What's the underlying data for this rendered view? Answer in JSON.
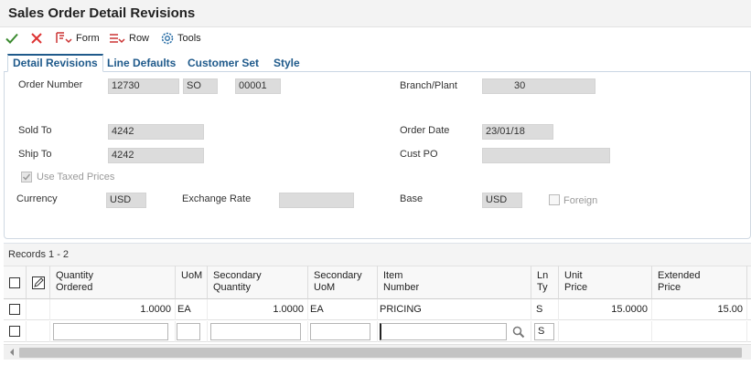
{
  "window": {
    "title": "Sales Order Detail Revisions"
  },
  "toolbar": {
    "ok_icon": "check-icon",
    "cancel_icon": "x-icon",
    "form_label": "Form",
    "row_label": "Row",
    "tools_label": "Tools"
  },
  "tabs": [
    "Detail Revisions",
    "Line Defaults",
    "Customer Set",
    "Style"
  ],
  "form": {
    "order_number_label": "Order Number",
    "order_number": "12730",
    "order_type": "SO",
    "order_company": "00001",
    "branch_plant_label": "Branch/Plant",
    "branch_plant": "30",
    "sold_to_label": "Sold To",
    "sold_to": "4242",
    "order_date_label": "Order Date",
    "order_date": "23/01/18",
    "ship_to_label": "Ship To",
    "ship_to": "4242",
    "cust_po_label": "Cust PO",
    "cust_po": "",
    "use_taxed_prices_label": "Use Taxed Prices",
    "currency_label": "Currency",
    "currency": "USD",
    "exchange_rate_label": "Exchange Rate",
    "exchange_rate": "",
    "base_label": "Base",
    "base": "USD",
    "foreign_label": "Foreign"
  },
  "records": {
    "label": "Records 1 - 2"
  },
  "grid": {
    "headers": [
      [
        "Quantity",
        "Ordered"
      ],
      [
        "UoM",
        ""
      ],
      [
        "Secondary",
        "Quantity"
      ],
      [
        "Secondary",
        "UoM"
      ],
      [
        "Item",
        "Number"
      ],
      [
        "Ln",
        "Ty"
      ],
      [
        "Unit",
        "Price"
      ],
      [
        "Extended",
        "Price"
      ]
    ],
    "rows": [
      {
        "quantity": "1.0000",
        "uom": "EA",
        "sec_quantity": "1.0000",
        "sec_uom": "EA",
        "item_number": "PRICING",
        "ln_ty": "S",
        "unit_price": "15.0000",
        "extended_price": "15.00"
      }
    ],
    "new_row": {
      "ln_ty": "S"
    }
  }
}
